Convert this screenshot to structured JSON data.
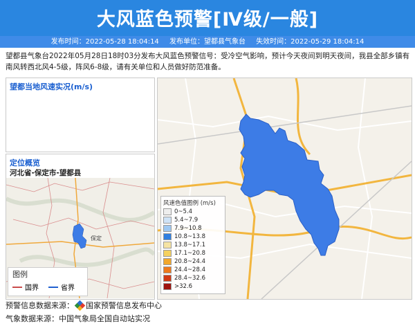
{
  "header": {
    "title": "大风蓝色预警[Ⅳ级/一般]",
    "issue_time": "发布时间：2022-05-28 18:04:14",
    "issuer": "发布单位：望都县气象台",
    "expire_time": "失效时间：2022-05-29 18:04:14"
  },
  "description": "望都县气象台2022年05月28日18时03分发布大风蓝色预警信号：受冷空气影响，预计今天夜间到明天夜间，我县全部乡镇有南风转西北风4-5级，阵风6-8级，请有关单位和人员做好防范准备。",
  "wind_panel": {
    "title": "望都当地风速实况(m/s)"
  },
  "location_panel": {
    "title": "定位概览",
    "region": "河北省-保定市-望都县"
  },
  "mini_legend": {
    "title": "图例",
    "national_border": "国界",
    "provincial_border": "省界"
  },
  "map_labels": {
    "baoding": "保定"
  },
  "wind_legend": {
    "title": "风速色值图例 (m/s)",
    "items": [
      {
        "label": "0~5.4",
        "color": "#eeeeee"
      },
      {
        "label": "5.4~7.9",
        "color": "#cfe3f7"
      },
      {
        "label": "7.9~10.8",
        "color": "#9ec8f2"
      },
      {
        "label": "10.8~13.8",
        "color": "#2f7fe0"
      },
      {
        "label": "13.8~17.1",
        "color": "#f5e3a3"
      },
      {
        "label": "17.1~20.8",
        "color": "#f5d15f"
      },
      {
        "label": "20.8~24.4",
        "color": "#f2a72c"
      },
      {
        "label": "24.4~28.4",
        "color": "#ee7a1e"
      },
      {
        "label": "28.4~32.6",
        "color": "#d23a16"
      },
      {
        "label": ">32.6",
        "color": "#9e1410"
      }
    ]
  },
  "footer": {
    "warning_source": "预警信息数据来源：",
    "warning_source_name": "国家预警信息发布中心",
    "weather_source": "气象数据来源：中国气象局全国自动站实况"
  },
  "colors": {
    "banner": "#2a86e0",
    "region_fill": "#3d7ce6",
    "panel_title": "#1a5fd0"
  }
}
